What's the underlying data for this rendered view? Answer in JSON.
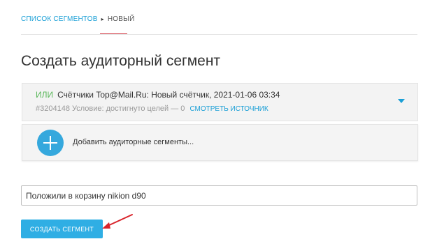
{
  "breadcrumb": {
    "parent": "список сегментов",
    "current": "новый"
  },
  "page": {
    "title": "Создать аудиторный сегмент"
  },
  "segment": {
    "operator": "или",
    "description": "Счётчики Top@Mail.Ru: Новый счётчик, 2021-01-06 03:34",
    "meta": "#3204148 Условие: достигнуто целей — 0",
    "link": "смотреть источник"
  },
  "add_segments": {
    "label": "Добавить аудиторные сегменты..."
  },
  "name_field": {
    "value": "Положили в корзину nikion d90"
  },
  "actions": {
    "create_label": "создать сегмент"
  },
  "colors": {
    "accent": "#1a9fd6",
    "button": "#2faee4",
    "operator_green": "#5cb85c",
    "annotation_red": "#d9232a"
  },
  "icons": {
    "breadcrumb_separator": "chevron-right-icon",
    "expand": "chevron-down-icon",
    "add": "plus-icon"
  }
}
